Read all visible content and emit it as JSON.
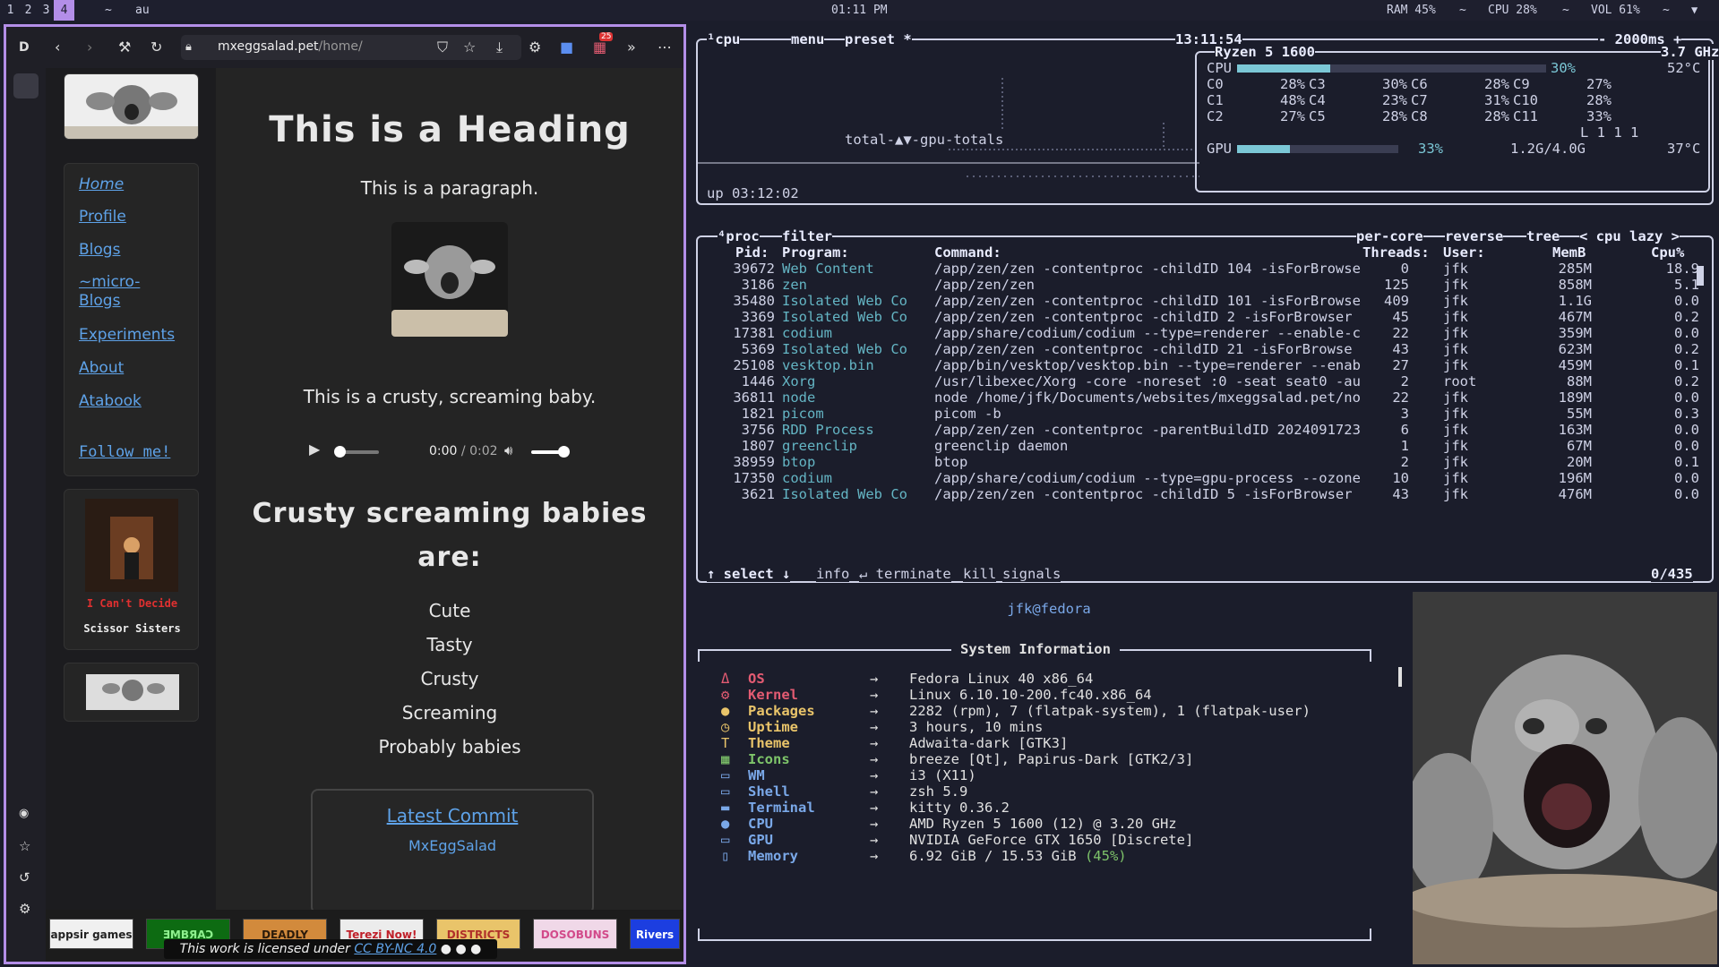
{
  "statusbar": {
    "workspaces": [
      "1",
      "2",
      "3",
      "4"
    ],
    "active_workspace": "4",
    "tilde": "~",
    "title": "au",
    "clock": "01:11 PM",
    "ram": "RAM 45%",
    "cpu": "CPU 28%",
    "vol": "VOL 61%",
    "sep": "~"
  },
  "browser": {
    "url_host": "mxeggsalad.pet",
    "url_path": "/home/",
    "profile_letter": "D",
    "badge": "25",
    "nav": [
      "Home",
      "Profile",
      "Blogs",
      "~micro-",
      "Blogs",
      "Experiments",
      "About",
      "Atabook",
      "Follow me!"
    ],
    "album_title": "I Can't Decide",
    "album_artist": "Scissor Sisters",
    "heading": "This is a Heading",
    "paragraph": "This is a paragraph.",
    "caption": "This is a crusty, screaming baby.",
    "audio_time": "0:00",
    "audio_sep": " / ",
    "audio_total": "0:02",
    "subheading_1": "Crusty screaming babies",
    "subheading_2": "are:",
    "list": [
      "Cute",
      "Tasty",
      "Crusty",
      "Screaming",
      "Probably babies"
    ],
    "commit_link": "Latest Commit",
    "commit_repo": "MxEggSalad",
    "license_prefix": "This work is licensed under ",
    "license_link": "CC BY-NC 4.0",
    "buttons": [
      "appsir games",
      "ƎMBЯAƆ",
      "DEADLY",
      "Terezi Now!",
      "DISTRICTS",
      "DOSOBUNS",
      "Rivers"
    ]
  },
  "btop": {
    "cpu_tab": "¹cpu",
    "menu": "menu",
    "preset": "preset *",
    "time": "13:11:54",
    "interval": "- 2000ms +",
    "graph_label": "total-▲▼-gpu-totals",
    "uptime": "up 03:12:02",
    "cpu_model": "Ryzen 5 1600",
    "freq": "3.7 GHz",
    "cpu_label": "CPU",
    "cpu_pct": "30%",
    "cpu_temp": "52°C",
    "cpu_pct_value": 30,
    "cores": [
      [
        "C0",
        "28%"
      ],
      [
        "C3",
        "30%"
      ],
      [
        "C6",
        "28%"
      ],
      [
        "C9",
        "27%"
      ],
      [
        "C1",
        "48%"
      ],
      [
        "C4",
        "23%"
      ],
      [
        "C7",
        "31%"
      ],
      [
        "C10",
        "28%"
      ],
      [
        "C2",
        "27%"
      ],
      [
        "C5",
        "28%"
      ],
      [
        "C8",
        "28%"
      ],
      [
        "C11",
        "33%"
      ]
    ],
    "load": "L 1 1 1",
    "gpu_label": "GPU",
    "gpu_pct": "33%",
    "gpu_mem": "1.2G/4.0G",
    "gpu_temp": "37°C",
    "gpu_pct_value": 33,
    "proc_tab": "⁴proc",
    "filter": "filter",
    "per_core": "per-core",
    "reverse": "reverse",
    "tree": "tree",
    "sort": "< cpu lazy >",
    "headers": [
      "Pid:",
      "Program:",
      "Command:",
      "Threads:",
      "User:",
      "MemB",
      "Cpu%"
    ],
    "processes": [
      [
        "39672",
        "Web Content",
        "/app/zen/zen -contentproc -childID 104 -isForBrowse",
        "0",
        "jfk",
        "285M",
        "18.9"
      ],
      [
        "3186",
        "zen",
        "/app/zen/zen",
        "125",
        "jfk",
        "858M",
        "5.1"
      ],
      [
        "35480",
        "Isolated Web Co",
        "/app/zen/zen -contentproc -childID 101 -isForBrowse",
        "409",
        "jfk",
        "1.1G",
        "0.0"
      ],
      [
        "3369",
        "Isolated Web Co",
        "/app/zen/zen -contentproc -childID 2 -isForBrowser",
        "45",
        "jfk",
        "467M",
        "0.2"
      ],
      [
        "17381",
        "codium",
        "/app/share/codium/codium --type=renderer --enable-c",
        "22",
        "jfk",
        "359M",
        "0.0"
      ],
      [
        "5369",
        "Isolated Web Co",
        "/app/zen/zen -contentproc -childID 21 -isForBrowse",
        "43",
        "jfk",
        "623M",
        "0.2"
      ],
      [
        "25108",
        "vesktop.bin",
        "/app/bin/vesktop/vesktop.bin --type=renderer --enab",
        "27",
        "jfk",
        "459M",
        "0.1"
      ],
      [
        "1446",
        "Xorg",
        "/usr/libexec/Xorg -core -noreset :0 -seat seat0 -au",
        "2",
        "root",
        "88M",
        "0.2"
      ],
      [
        "36811",
        "node",
        "node /home/jfk/Documents/websites/mxeggsalad.pet/no",
        "22",
        "jfk",
        "189M",
        "0.0"
      ],
      [
        "1821",
        "picom",
        "picom -b",
        "3",
        "jfk",
        "55M",
        "0.3"
      ],
      [
        "3756",
        "RDD Process",
        "/app/zen/zen -contentproc -parentBuildID 2024091723",
        "6",
        "jfk",
        "163M",
        "0.0"
      ],
      [
        "1807",
        "greenclip",
        "greenclip daemon",
        "1",
        "jfk",
        "67M",
        "0.0"
      ],
      [
        "38959",
        "btop",
        "btop",
        "2",
        "jfk",
        "20M",
        "0.1"
      ],
      [
        "17350",
        "codium",
        "/app/share/codium/codium --type=gpu-process --ozone",
        "10",
        "jfk",
        "196M",
        "0.0"
      ],
      [
        "3621",
        "Isolated Web Co",
        "/app/zen/zen -contentproc -childID 5 -isForBrowser",
        "43",
        "jfk",
        "476M",
        "0.0"
      ]
    ],
    "footer": [
      "↑ select ↓",
      "info",
      "↵ terminate",
      "kill",
      "signals"
    ],
    "count": "0/435"
  },
  "fetch": {
    "user_host": "jfk@fedora",
    "title": "System Information",
    "arrow": "→",
    "items": [
      {
        "icon": "Δ",
        "label": "OS",
        "value": "Fedora Linux 40 x86_64",
        "color": "#e35b72"
      },
      {
        "icon": "⚙",
        "label": "Kernel",
        "value": "Linux 6.10.10-200.fc40.x86_64",
        "color": "#e35b72"
      },
      {
        "icon": "●",
        "label": "Packages",
        "value": "2282 (rpm), 7 (flatpak-system), 1 (flatpak-user)",
        "color": "#e9c46a"
      },
      {
        "icon": "◷",
        "label": "Uptime",
        "value": "3 hours, 10 mins",
        "color": "#e9c46a"
      },
      {
        "icon": "T",
        "label": "Theme",
        "value": "Adwaita-dark [GTK3]",
        "color": "#e9c46a"
      },
      {
        "icon": "▦",
        "label": "Icons",
        "value": "breeze [Qt], Papirus-Dark [GTK2/3]",
        "color": "#7ec46a"
      },
      {
        "icon": "▭",
        "label": "WM",
        "value": "i3 (X11)",
        "color": "#7aa8e8"
      },
      {
        "icon": "▭",
        "label": "Shell",
        "value": "zsh 5.9",
        "color": "#7aa8e8"
      },
      {
        "icon": "▬",
        "label": "Terminal",
        "value": "kitty 0.36.2",
        "color": "#7aa8e8"
      },
      {
        "icon": "●",
        "label": "CPU",
        "value": "AMD Ryzen 5 1600 (12) @ 3.20 GHz",
        "color": "#7aa8e8"
      },
      {
        "icon": "▭",
        "label": "GPU",
        "value": "NVIDIA GeForce GTX 1650 [Discrete]",
        "color": "#7aa8e8"
      },
      {
        "icon": "▯",
        "label": "Memory",
        "value": "6.92 GiB / 15.53 GiB ",
        "color": "#7aa8e8"
      }
    ],
    "memory_pct": "(45%)"
  },
  "colors": {
    "accent": "#b38ee8",
    "btop_title": "#e9ecff",
    "btop_proc_name": "#64b5c4",
    "link": "#5ea2e8",
    "album_title": "#e03030"
  }
}
